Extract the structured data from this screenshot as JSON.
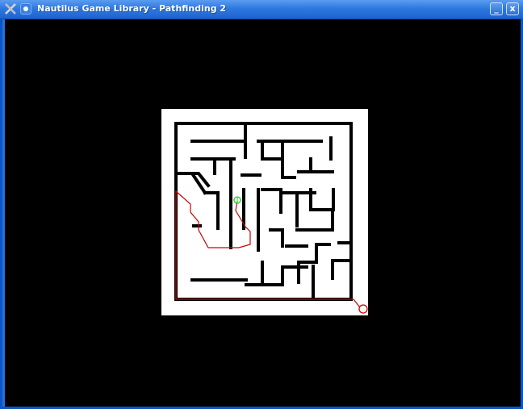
{
  "window": {
    "title": "Nautilus Game Library - Pathfinding 2",
    "icon": "nautilus-app-icon",
    "buttons": {
      "minimize": "_",
      "close": "x"
    }
  },
  "colors": {
    "titlebar": "#2f78e0",
    "background": "#000000",
    "maze_floor": "#ffffff",
    "maze_wall": "#000000",
    "path": "#cc0000",
    "start_marker": "#22cc22",
    "goal_marker": "#cc0000"
  }
}
